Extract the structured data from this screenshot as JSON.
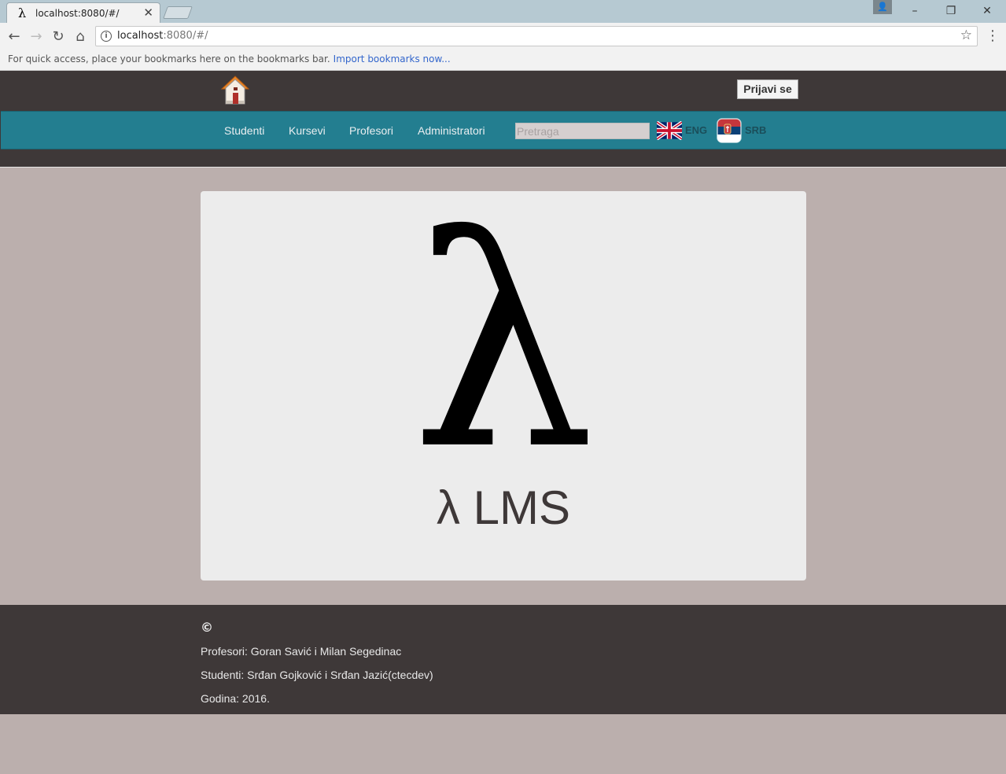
{
  "browser": {
    "tab_title": "localhost:8080/#/",
    "tab_favicon": "λ",
    "url_host": "localhost",
    "url_rest": ":8080/#/",
    "bookmarks_bar_text": "For quick access, place your bookmarks here on the bookmarks bar.",
    "bookmarks_import_link": "Import bookmarks now..."
  },
  "header": {
    "login_label": "Prijavi se",
    "nav": [
      "Studenti",
      "Kursevi",
      "Profesori",
      "Administratori"
    ],
    "search_placeholder": "Pretraga",
    "lang_eng": "ENG",
    "lang_srb": "SRB"
  },
  "main": {
    "logo_symbol": "λ",
    "logo_text": "λ LMS"
  },
  "footer": {
    "copyright": "©",
    "professors": "Profesori: Goran Savić i Milan Segedinac",
    "students": "Studenti: Srđan Gojković i Srđan Jazić(ctecdev)",
    "year": "Godina: 2016."
  },
  "colors": {
    "page_bg": "#bbafad",
    "header_bg": "#3e3838",
    "navbar_bg": "#237e90",
    "card_bg": "#ececec"
  }
}
